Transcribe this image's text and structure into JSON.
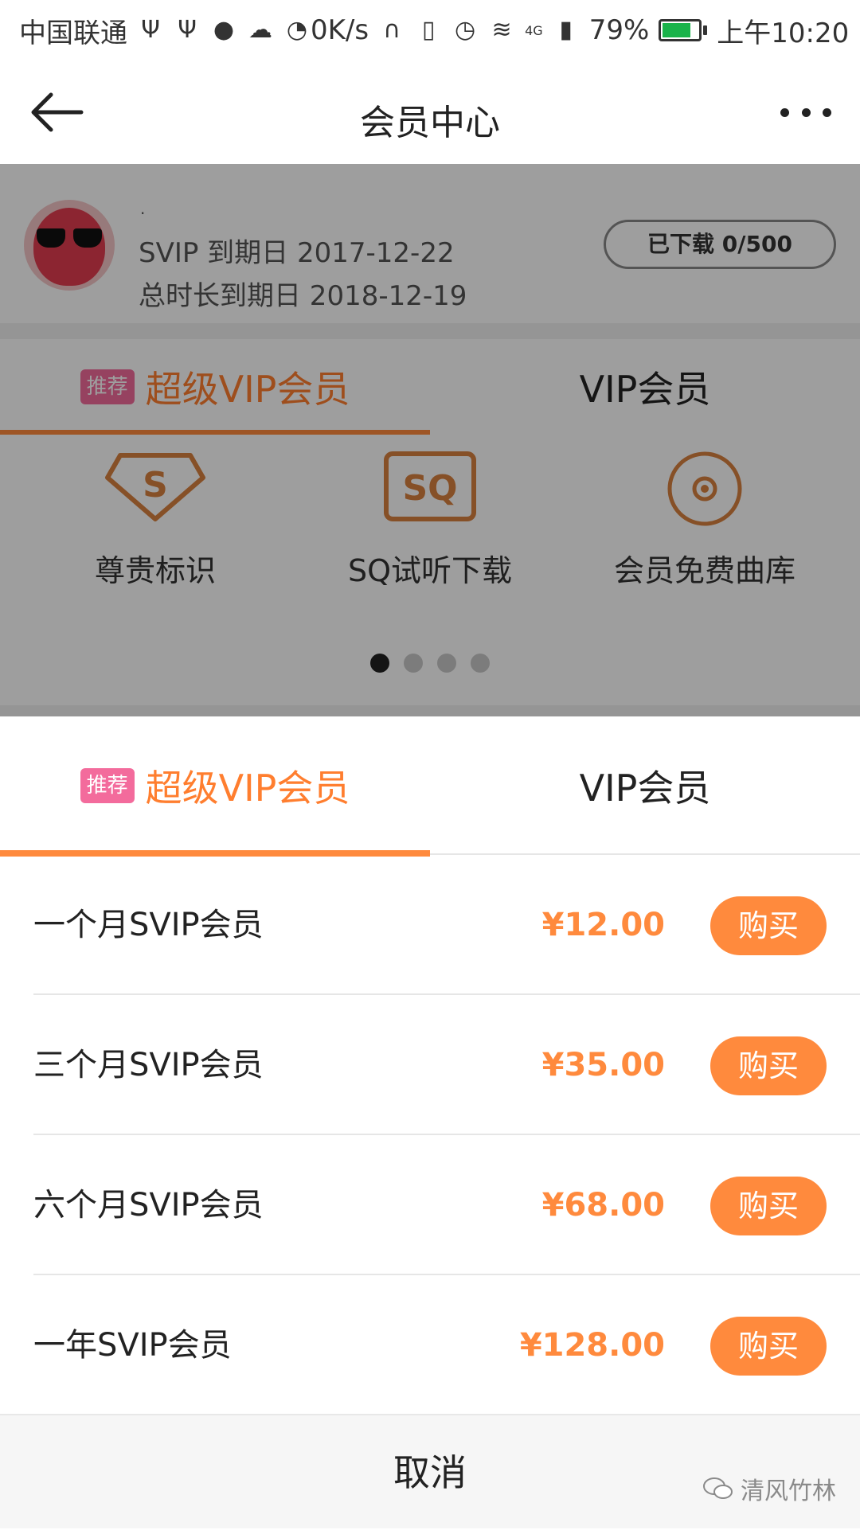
{
  "status_bar": {
    "carrier": "中国联通",
    "net_speed": "0K/s",
    "network_type": "4G",
    "battery": "79%",
    "battery_level": 0.79,
    "time": "上午10:20"
  },
  "header": {
    "title": "会员中心"
  },
  "profile": {
    "username": "·",
    "svip_expire": "SVIP 到期日 2017-12-22",
    "total_expire": "总时长到期日 2018-12-19",
    "downloaded": "已下载 0/500"
  },
  "tabs": {
    "tag": "推荐",
    "svip_label": "超级VIP会员",
    "vip_label": "VIP会员"
  },
  "features": [
    {
      "icon": "badge-s-icon",
      "label": "尊贵标识"
    },
    {
      "icon": "sq-icon",
      "label": "SQ试听下载"
    },
    {
      "icon": "disc-icon",
      "label": "会员免费曲库"
    }
  ],
  "carousel": {
    "pages": 4,
    "active": 0
  },
  "packages": [
    {
      "name": "一个月SVIP会员",
      "price": "¥12.00",
      "buy_label": "购买"
    },
    {
      "name": "三个月SVIP会员",
      "price": "¥35.00",
      "buy_label": "购买"
    },
    {
      "name": "六个月SVIP会员",
      "price": "¥68.00",
      "buy_label": "购买"
    },
    {
      "name": "一年SVIP会员",
      "price": "¥128.00",
      "buy_label": "购买"
    }
  ],
  "cancel_label": "取消",
  "watermark": "清风竹林",
  "colors": {
    "accent": "#ff8a3d",
    "tag": "#f36b9c"
  }
}
